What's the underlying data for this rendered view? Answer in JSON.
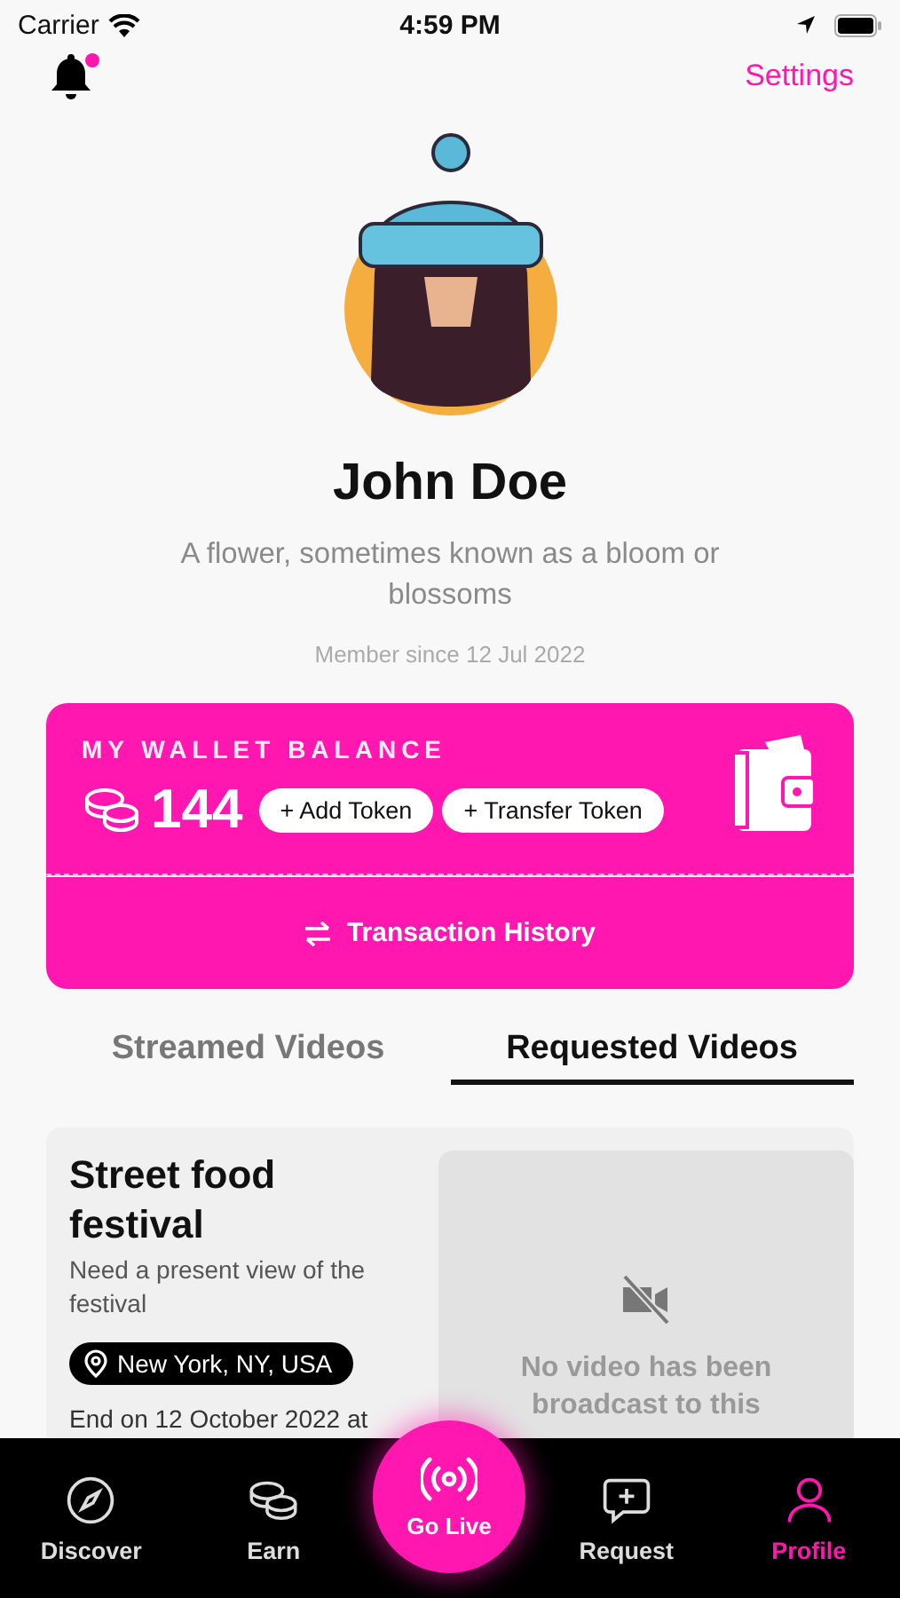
{
  "status_bar": {
    "carrier": "Carrier",
    "time": "4:59 PM"
  },
  "header": {
    "notification_badge": true,
    "settings": "Settings"
  },
  "profile": {
    "name": "John Doe",
    "bio": "A flower, sometimes known as a bloom or blossoms",
    "member_since": "Member since 12 Jul 2022"
  },
  "wallet": {
    "title": "MY WALLET BALANCE",
    "balance": "144",
    "actions": [
      "+ Add Token",
      "+ Transfer Token"
    ],
    "history": "Transaction History"
  },
  "tabs": [
    {
      "label": "Streamed Videos",
      "selected": false
    },
    {
      "label": "Requested Videos",
      "selected": true
    }
  ],
  "requests": [
    {
      "title": "Street food festival",
      "description": "Need a present view of the festival",
      "location": "New York, NY, USA",
      "end": "End on 12 October 2022 at",
      "video_placeholder": "No video has been broadcast to this"
    }
  ],
  "nav": [
    {
      "label": "Discover",
      "selected": false
    },
    {
      "label": "Earn",
      "selected": false
    },
    {
      "label": "Request",
      "selected": false
    },
    {
      "label": "Profile",
      "selected": true
    }
  ],
  "go_live": {
    "label": "Go Live"
  }
}
